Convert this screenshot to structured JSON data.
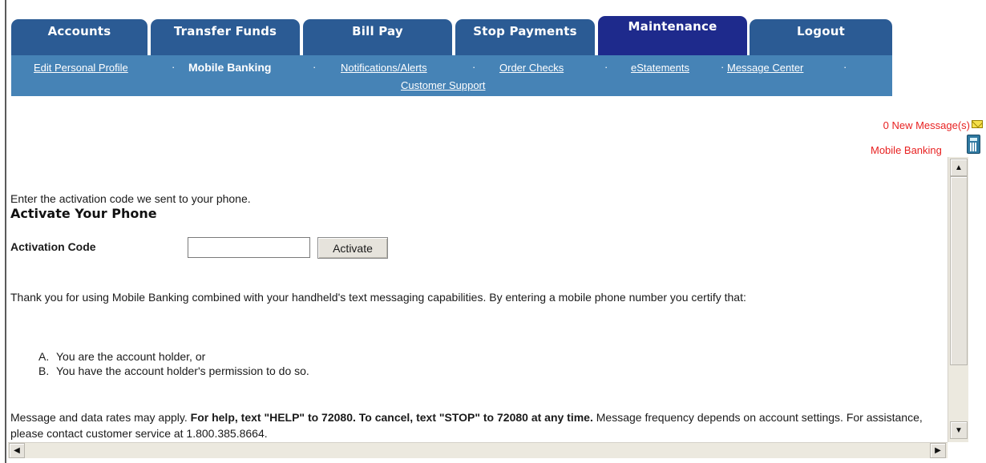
{
  "tabs": [
    {
      "label": "Accounts",
      "active": false
    },
    {
      "label": "Transfer Funds",
      "active": false
    },
    {
      "label": "Bill Pay",
      "active": false
    },
    {
      "label": "Stop Payments",
      "active": false
    },
    {
      "label": "Maintenance",
      "active": true
    },
    {
      "label": "Logout",
      "active": false
    }
  ],
  "subnav": {
    "edit_profile": "Edit Personal Profile",
    "mobile_banking": "Mobile Banking",
    "notifications": "Notifications/Alerts",
    "order_checks": "Order Checks",
    "estatements": "eStatements",
    "message_center": "Message Center",
    "customer_support": "Customer Support",
    "separator": "·"
  },
  "header_links": {
    "new_messages": "0 New Message(s)",
    "mobile_banking": "Mobile Banking"
  },
  "page": {
    "title": "Activate Your Phone",
    "intro": "Enter the activation code we sent to your phone.",
    "activation_label": "Activation Code",
    "activation_value": "",
    "activate_button": "Activate",
    "thanks_text": "Thank you for using Mobile Banking combined with your handheld's text messaging capabilities. By entering a mobile phone number you certify that:",
    "conditions": [
      {
        "mark": "A.",
        "text": "You are the account holder, or"
      },
      {
        "mark": "B.",
        "text": "You have the account holder's permission to do so."
      }
    ],
    "rates_prefix": "Message and data rates may apply. ",
    "rates_bold": "For help, text \"HELP\" to 72080. To cancel, text \"STOP\" to 72080 at any time.",
    "rates_suffix": " Message frequency depends on account settings. For assistance, please contact customer service at 1.800.385.8664."
  },
  "icons": {
    "envelope": "envelope-icon",
    "calculator": "calculator-icon",
    "scroll_up": "▲",
    "scroll_down": "▼",
    "scroll_left": "◀",
    "scroll_right": "▶"
  },
  "colors": {
    "tab": "#2b5b94",
    "tab_active": "#1e2a8c",
    "subnav": "#4683b6",
    "alert_link": "#e82222"
  }
}
